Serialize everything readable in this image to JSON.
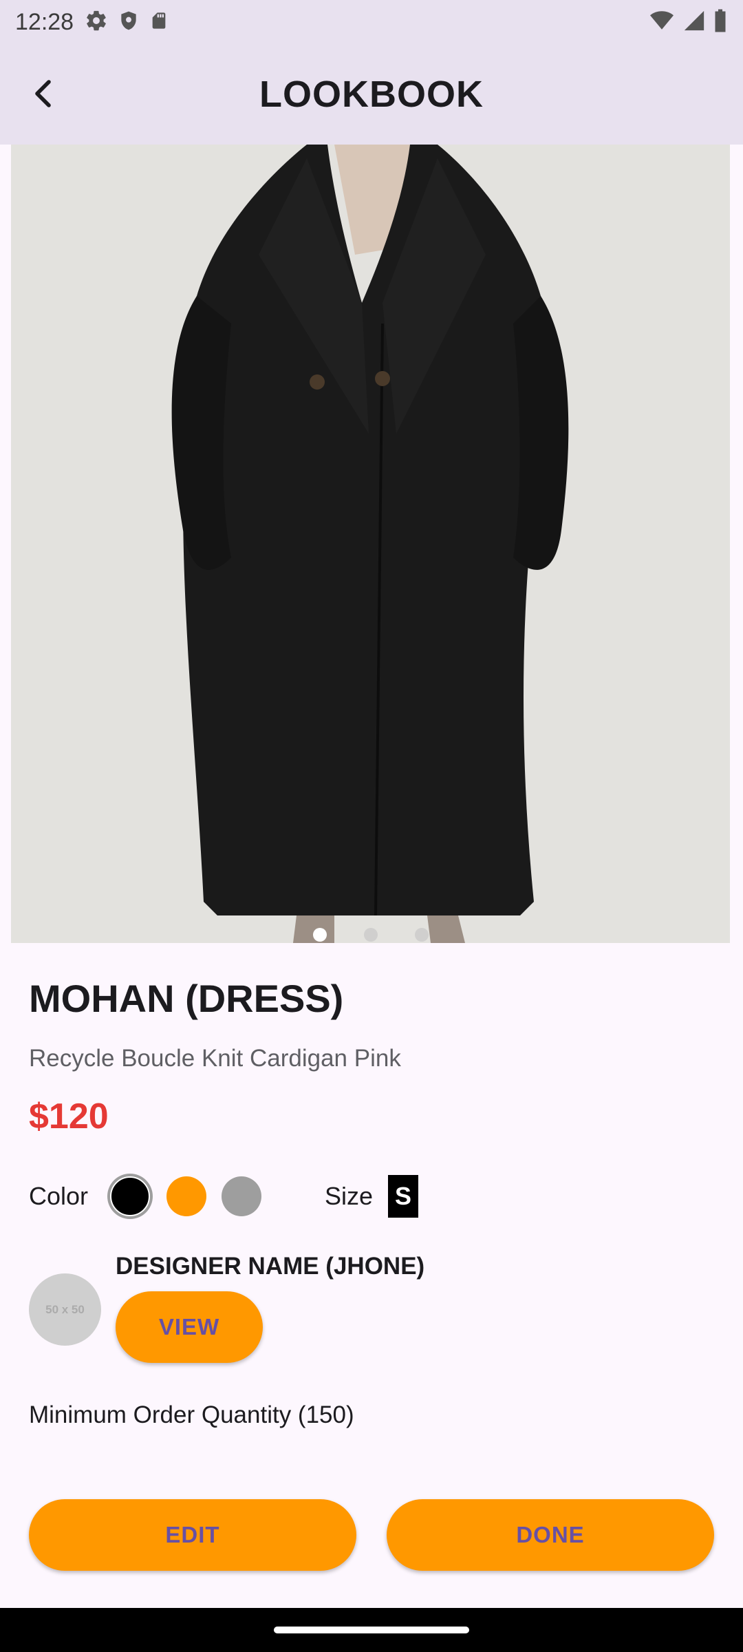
{
  "status_bar": {
    "time": "12:28",
    "icons_left": [
      "settings-icon",
      "shield-icon",
      "sd-card-icon"
    ],
    "icons_right": [
      "wifi-icon",
      "signal-icon",
      "battery-icon"
    ]
  },
  "app_bar": {
    "title": "LOOKBOOK",
    "back_icon": "chevron-left-icon"
  },
  "carousel": {
    "dot_count": 3,
    "active_index": 0
  },
  "product": {
    "name": "MOHAN (DRESS)",
    "description": "Recycle Boucle Knit Cardigan Pink",
    "price": "$120",
    "color_label": "Color",
    "colors": [
      "#000000",
      "#FF9800",
      "#9E9E9E"
    ],
    "selected_color_index": 0,
    "size_label": "Size",
    "size_value": "S"
  },
  "designer": {
    "name": "DESIGNER NAME (JHONE)",
    "avatar_placeholder": "50 x 50",
    "view_label": "VIEW"
  },
  "moq_text": "Minimum Order Quantity (150)",
  "actions": {
    "edit_label": "EDIT",
    "done_label": "DONE"
  },
  "colors": {
    "accent": "#FF9800",
    "button_text": "#6750A4",
    "price": "#E53935",
    "app_bar": "#E8E1EF",
    "background": "#FDF7FE"
  }
}
